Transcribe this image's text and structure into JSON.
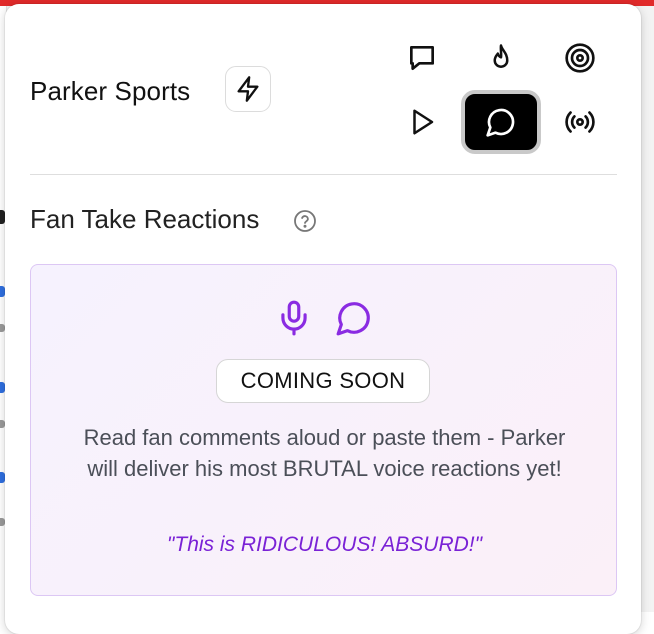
{
  "header": {
    "brand_title": "Parker Sports",
    "bolt_icon": "lightning-bolt-icon",
    "modes": [
      {
        "icon": "chat-square-icon",
        "active": false
      },
      {
        "icon": "flame-icon",
        "active": false
      },
      {
        "icon": "target-icon",
        "active": false
      },
      {
        "icon": "play-icon",
        "active": false
      },
      {
        "icon": "chat-round-icon",
        "active": true
      },
      {
        "icon": "broadcast-icon",
        "active": false
      }
    ]
  },
  "section": {
    "title": "Fan Take Reactions",
    "help_icon": "help-circle-icon"
  },
  "card": {
    "icons": [
      "microphone-icon",
      "chat-round-icon"
    ],
    "badge": "COMING SOON",
    "description": "Read fan comments aloud or paste them - Parker will deliver his most BRUTAL voice reactions yet!",
    "quote": "\"This is RIDICULOUS! ABSURD!\""
  },
  "colors": {
    "accent": "#8a2be2",
    "quote_text": "#7a22d6",
    "top_bar": "#e12a2a",
    "active_button": "#000000"
  }
}
